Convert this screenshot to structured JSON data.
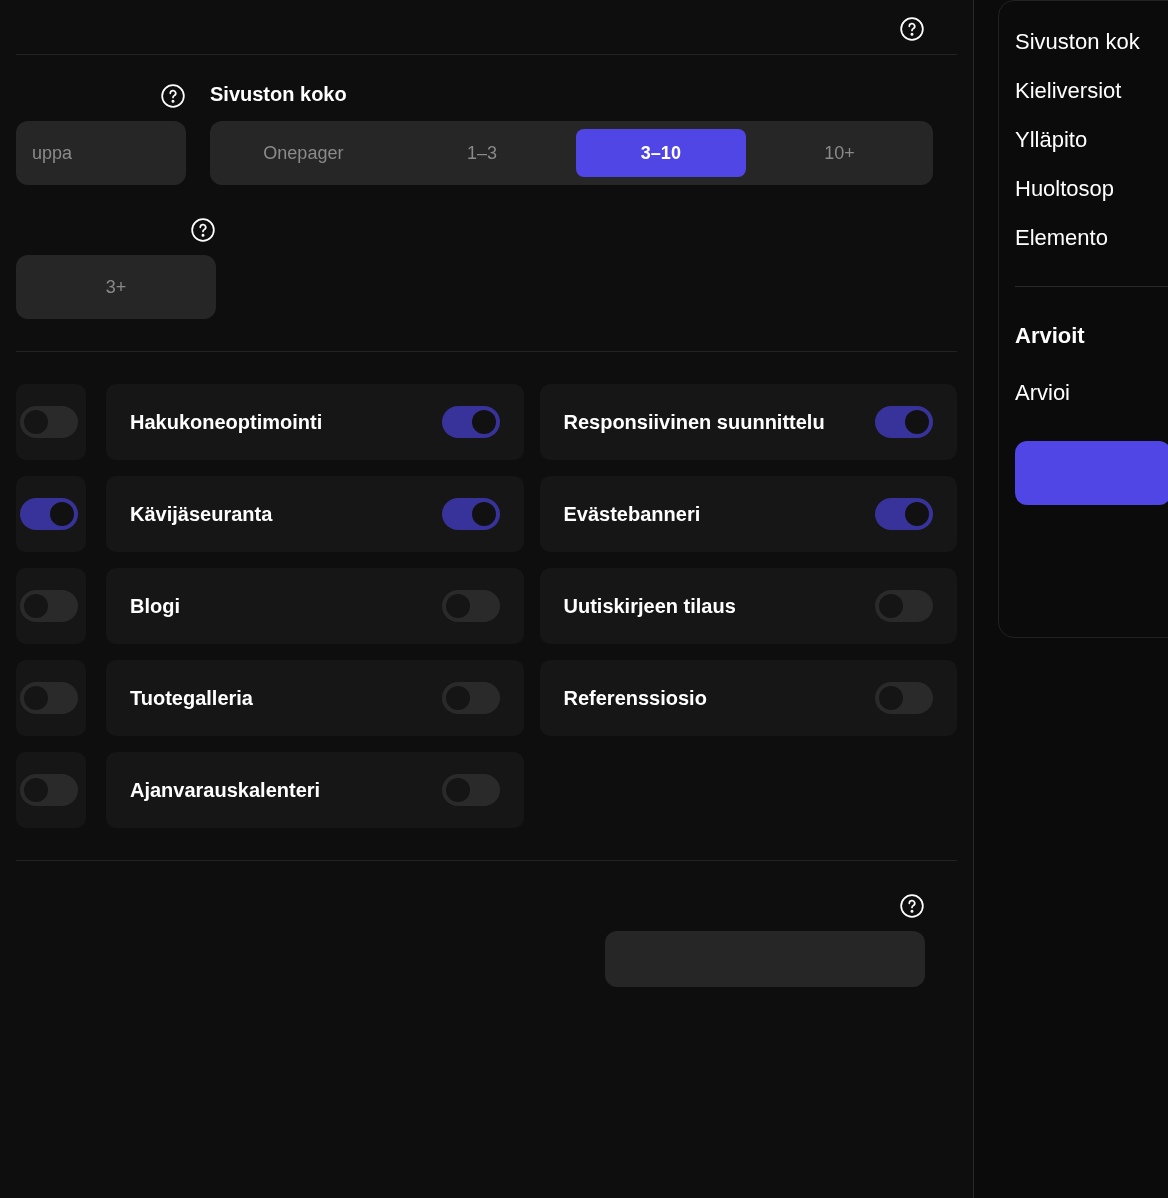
{
  "main": {
    "type_field": {
      "value": "uppa"
    },
    "size": {
      "label": "Sivuston koko",
      "options": [
        {
          "label": "Onepager",
          "selected": false
        },
        {
          "label": "1–3",
          "selected": false
        },
        {
          "label": "3–10",
          "selected": true
        },
        {
          "label": "10+",
          "selected": false
        }
      ]
    },
    "languages": {
      "options": [
        {
          "label": "3+",
          "selected": false
        }
      ]
    },
    "features_partial": [
      {
        "on": false
      },
      {
        "on": true
      },
      {
        "on": false
      },
      {
        "on": false
      },
      {
        "on": false
      }
    ],
    "features": [
      {
        "label": "Hakukoneoptimointi",
        "on": true
      },
      {
        "label": "Responsiivinen suunnittelu",
        "on": true
      },
      {
        "label": "Kävijäseuranta",
        "on": true
      },
      {
        "label": "Evästebanneri",
        "on": true
      },
      {
        "label": "Blogi",
        "on": false
      },
      {
        "label": "Uutiskirjeen tilaus",
        "on": false
      },
      {
        "label": "Tuotegalleria",
        "on": false
      },
      {
        "label": "Referenssiosio",
        "on": false
      },
      {
        "label": "Ajanvarauskalenteri",
        "on": false
      }
    ]
  },
  "sidebar": {
    "summary": [
      "Sivuston kok",
      "Kieliversiot",
      "Ylläpito",
      "Huoltosop",
      "Elemento"
    ],
    "estimate": {
      "title": "Arvioit",
      "text": "Arvioi"
    }
  }
}
